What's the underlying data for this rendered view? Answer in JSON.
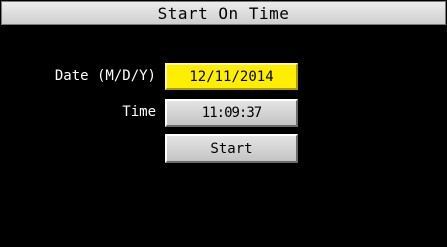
{
  "window": {
    "title": "Start On Time"
  },
  "form": {
    "date_label": "Date (M/D/Y)",
    "date_value": "12/11/2014",
    "time_label": "Time",
    "time_value": "11:09:37",
    "start_label": "Start"
  },
  "colors": {
    "background": "#000000",
    "selected_field": "#ffee00",
    "button": "#d4d4d4",
    "title_bar": "#dcdcdc"
  }
}
